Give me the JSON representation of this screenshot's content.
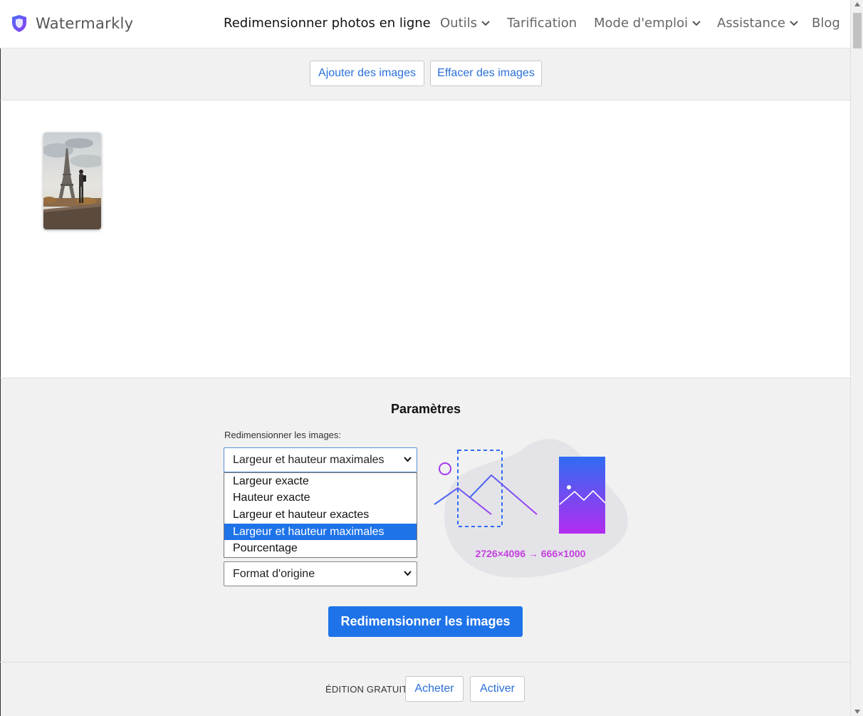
{
  "app": {
    "brand": "Watermarkly"
  },
  "nav": {
    "items": [
      {
        "label": "Redimensionner photos en ligne",
        "dropdown": false,
        "active": true
      },
      {
        "label": "Outils",
        "dropdown": true
      },
      {
        "label": "Tarification",
        "dropdown": false
      },
      {
        "label": "Mode d'emploi",
        "dropdown": true
      },
      {
        "label": "Assistance",
        "dropdown": true
      },
      {
        "label": "Blog",
        "dropdown": false
      }
    ]
  },
  "toolbar": {
    "add_label": "Ajouter des images",
    "clear_label": "Effacer des images"
  },
  "settings": {
    "title": "Paramètres",
    "resize_label": "Redimensionner les images:",
    "resize_selected": "Largeur et hauteur maximales",
    "resize_options": [
      "Largeur exacte",
      "Hauteur exacte",
      "Largeur et hauteur exactes",
      "Largeur et hauteur maximales",
      "Pourcentage"
    ],
    "format_selected": "Format d'origine",
    "dimensions_text": "2726×4096 → 666×1000",
    "submit_label": "Redimensionner les images"
  },
  "footer": {
    "edition_label": "ÉDITION GRATUIT",
    "buy_label": "Acheter",
    "activate_label": "Activer"
  },
  "colors": {
    "accent": "#1e73e8",
    "link": "#2a6fdb",
    "illustration": "#c63fe0"
  }
}
